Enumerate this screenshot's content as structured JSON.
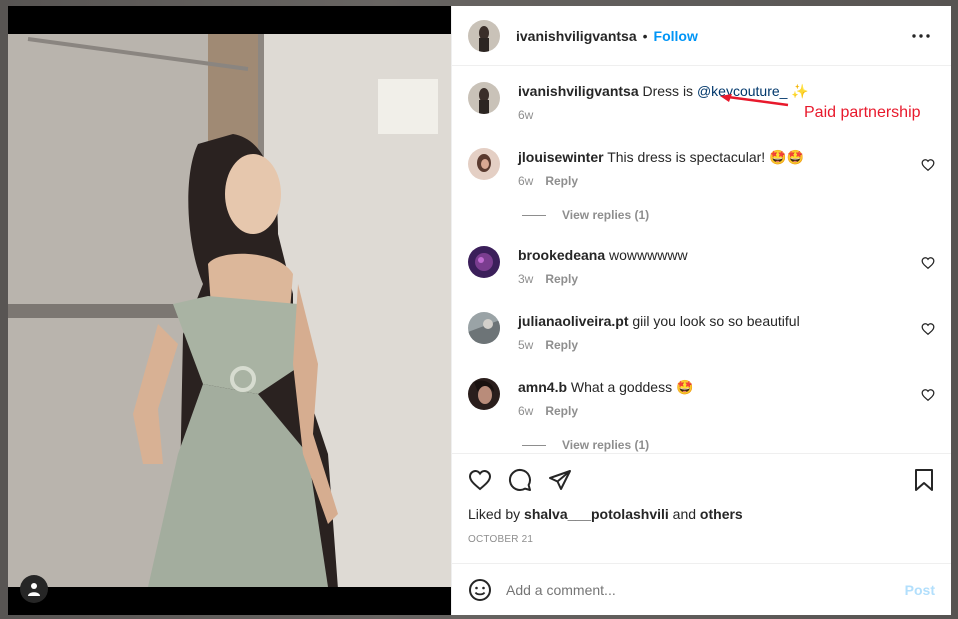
{
  "post": {
    "author": "ivanishviligvantsa",
    "follow_label": "Follow",
    "separator": "•",
    "caption": {
      "username": "ivanishviligvantsa",
      "text": "Dress is",
      "mention": "@keycouture_",
      "emoji": "✨",
      "time": "6w"
    },
    "annotation": "Paid partnership",
    "annotation_color": "#e8192c"
  },
  "comments": [
    {
      "username": "jlouisewinter",
      "text": "This dress is spectacular! 🤩🤩",
      "time": "6w",
      "reply_label": "Reply",
      "view_replies": "View replies (1)"
    },
    {
      "username": "brookedeana",
      "text": "wowwwwww",
      "time": "3w",
      "reply_label": "Reply"
    },
    {
      "username": "julianaoliveira.pt",
      "text": "giil you look so so beautiful",
      "time": "5w",
      "reply_label": "Reply"
    },
    {
      "username": "amn4.b",
      "text": "What a goddess 🤩",
      "time": "6w",
      "reply_label": "Reply",
      "view_replies": "View replies (1)"
    }
  ],
  "likes": {
    "prefix": "Liked by",
    "user": "shalva___potolashvili",
    "and": "and",
    "others": "others"
  },
  "date": "OCTOBER 21",
  "composer": {
    "placeholder": "Add a comment...",
    "post_label": "Post"
  },
  "icons": [
    "heart-icon",
    "comment-icon",
    "share-icon",
    "bookmark-icon",
    "more-icon",
    "emoji-icon",
    "user-tag-icon"
  ],
  "colors": {
    "follow": "#0095f6",
    "mention": "#00376b",
    "post_disabled": "#b2dffc"
  }
}
